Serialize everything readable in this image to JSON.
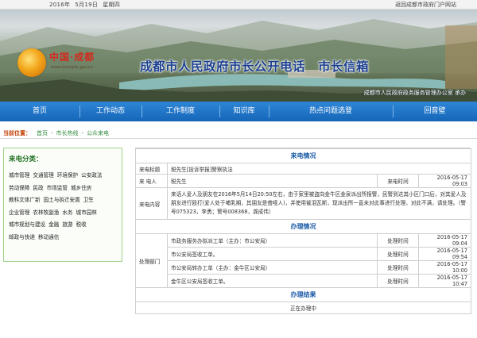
{
  "topbar": {
    "year": "2016年",
    "monthday": "5月19日",
    "weekday": "星期四",
    "portal_link": "返回成都市政府门户网站"
  },
  "banner": {
    "logo_name": "中国·成都",
    "logo_site": "www.chengdu.gov.cn",
    "title": "成都市人民政府市长公开电话　市长信箱",
    "org": "成都市人民政府政务服务管理办公室 承办"
  },
  "nav": {
    "items": [
      "首页",
      "工作动态",
      "工作制度",
      "知识库",
      "热点问题选登",
      "回音壁"
    ]
  },
  "breadcrumb": {
    "label": "当前位置：",
    "items": [
      "首页",
      "-",
      "市长热线",
      "-",
      "公众来电"
    ]
  },
  "sidebar": {
    "title": "来电分类：",
    "categories": [
      "城市管理",
      "交通管理",
      "环境保护",
      "公安政法",
      "劳动保障",
      "民政",
      "市场监管",
      "城乡住房",
      "教科文体广新",
      "国土与拆迁安置",
      "卫生",
      "企业管理",
      "农林牧副渔",
      "水务",
      "城市园林",
      "城市规划与建设",
      "金融",
      "旅游",
      "税收",
      "邮政与快递",
      "移动通信"
    ]
  },
  "call": {
    "section_title": "来电情况",
    "subject_label": "来电标题",
    "subject": "税先生[投诉举报]警察执法",
    "caller_label": "来 电人",
    "caller": "税先生",
    "time_label": "来电时间",
    "time": "2016-05-17 09:03",
    "content_label": "来电内容",
    "content": "来话人爱人及朋友在2016年5月14日20:50左右，由于家里被盗向金牛区金泉派出所报警，民警到达其小区门口后，对其爱人及朋友进行殴打(爱人处于哺乳期，其朋友是聋哑人)，并使用催泪瓦斯，现派出所一直未对此事进行处理，对此不满，请处理。（警号075323，李勇；警号008368，龚成伟）"
  },
  "handling": {
    "section_title": "办理情况",
    "dept_label": "处理部门",
    "time_label": "处理时间",
    "records": [
      {
        "text": "市政务服务办拟派工单（主办：市公安局）",
        "time": "2016-05-17 09:04"
      },
      {
        "text": "市公安局签收工单。",
        "time": "2016-05-17 09:54"
      },
      {
        "text": "市公安局转办工单（主办：金牛区公安局）",
        "time": "2016-05-17 10:00"
      },
      {
        "text": "金牛区公安局签收工单。",
        "time": "2016-05-17 10:47"
      }
    ]
  },
  "result": {
    "section_title": "办理结果",
    "status": "正在办理中"
  },
  "colors": {
    "nav": "#1a6fc4",
    "title_blue": "#1b3f8f",
    "section_blue": "#1a5aa8",
    "sidebar_border": "#9fd08a",
    "breadcrumb_label": "#c23c00",
    "breadcrumb_link": "#2e8b3c"
  }
}
